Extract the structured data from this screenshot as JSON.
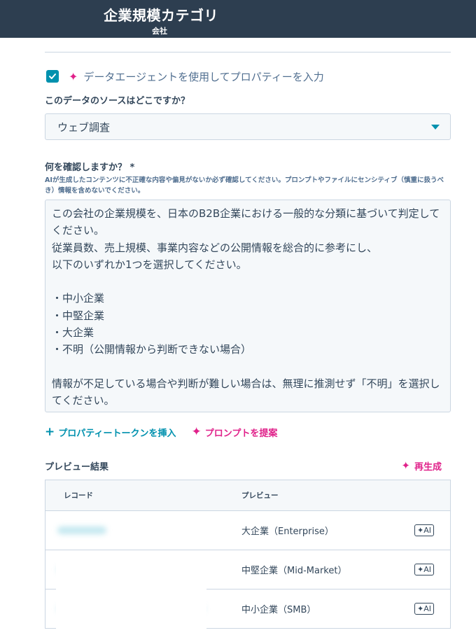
{
  "header": {
    "title": "企業規模カテゴリ",
    "subtitle": "会社"
  },
  "agent": {
    "checked": true,
    "label": "データエージェントを使用してプロパティーを入力"
  },
  "source": {
    "label": "このデータのソースはどこですか？",
    "value": "ウェブ調査"
  },
  "question": {
    "label": "何を確認しますか？ *",
    "help": "AIが生成したコンテンツに不正確な内容や偏見がないか必ず確認してください。プロンプトやファイルにセンシティブ（慎重に扱うべき）情報を含めないでください。",
    "prompt": "この会社の企業規模を、日本のB2B企業における一般的な分類に基づいて判定してください。\n従業員数、売上規模、事業内容などの公開情報を総合的に参考にし、\n以下のいずれか1つを選択してください。\n\n・中小企業\n・中堅企業\n・大企業\n・不明（公開情報から判断できない場合）\n\n情報が不足している場合や判断が難しい場合は、無理に推測せず「不明」を選択してください。"
  },
  "actions": {
    "insert_token": "プロパティートークンを挿入",
    "suggest_prompt": "プロンプトを提案"
  },
  "preview": {
    "title": "プレビュー結果",
    "regenerate": "再生成",
    "columns": {
      "record": "レコード",
      "preview": "プレビュー"
    },
    "rows": [
      {
        "value": "大企業（Enterprise）",
        "badge": "AI"
      },
      {
        "value": "中堅企業（Mid-Market）",
        "badge": "AI"
      },
      {
        "value": "中小企業（SMB）",
        "badge": "AI"
      }
    ]
  },
  "colors": {
    "header_bg": "#2d3e50",
    "accent_teal": "#0091ae",
    "accent_pink": "#e0218a"
  }
}
